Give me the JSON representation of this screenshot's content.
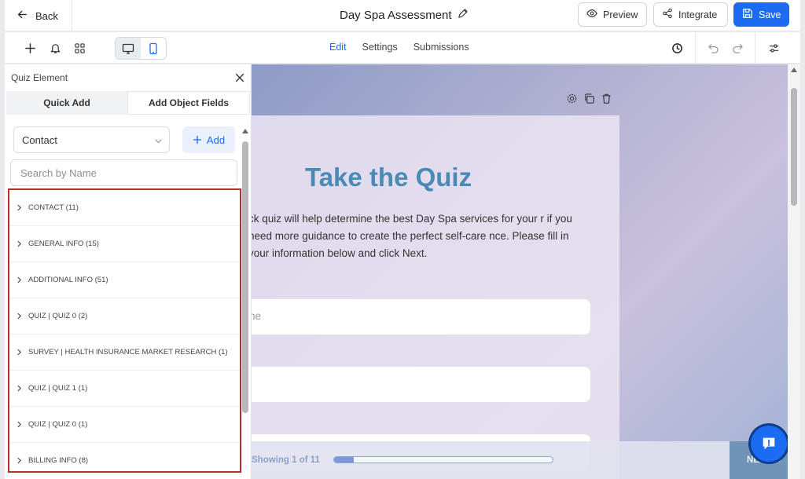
{
  "topbar": {
    "back_label": "Back",
    "title": "Day Spa Assessment",
    "preview_label": "Preview",
    "integrate_label": "Integrate",
    "save_label": "Save"
  },
  "toolbar": {
    "tabs": [
      {
        "label": "Edit",
        "active": true
      },
      {
        "label": "Settings",
        "active": false
      },
      {
        "label": "Submissions",
        "active": false
      }
    ]
  },
  "panel": {
    "title": "Quiz Element",
    "tabs": [
      "Quick Add",
      "Add Object Fields"
    ],
    "select_value": "Contact",
    "add_label": "Add",
    "search_placeholder": "Search by Name",
    "items": [
      {
        "label": "CONTACT (11)"
      },
      {
        "label": "GENERAL INFO (15)"
      },
      {
        "label": "ADDITIONAL INFO (51)"
      },
      {
        "label": "QUIZ | QUIZ 0 (2)"
      },
      {
        "label": "SURVEY | HEALTH INSURANCE MARKET RESEARCH (1)"
      },
      {
        "label": "QUIZ | QUIZ 1 (1)"
      },
      {
        "label": "QUIZ | QUIZ 0 (1)"
      },
      {
        "label": "BILLING INFO (8)"
      }
    ]
  },
  "canvas": {
    "quiz_title": "Take the Quiz",
    "quiz_text": "ck quiz will help determine the best Day Spa services for your r if you need more guidance to create the perfect self-care nce. Please fill in your information below and click Next.",
    "field_placeholder": "ne",
    "showing_text": "Showing 1 of 11",
    "progress_fraction": 0.09,
    "next_label": "NEXT"
  },
  "colors": {
    "accent": "#1b6cf2",
    "quiz_title": "#4a8ab4",
    "highlight_border": "#b52f2f"
  }
}
